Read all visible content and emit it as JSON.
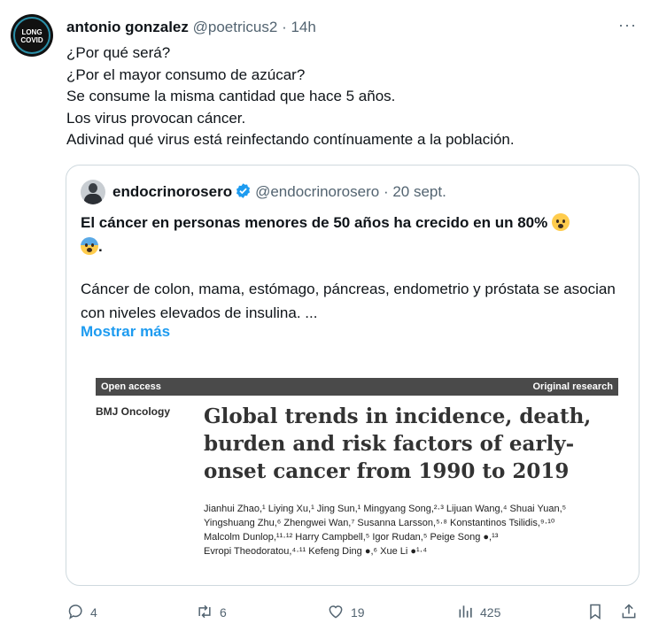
{
  "tweet": {
    "author_name": "antonio gonzalez",
    "handle": "@poetricus2",
    "separator": "·",
    "time": "14h",
    "more_label": "···",
    "avatar_text_1": "LONG",
    "avatar_text_2": "COVID",
    "lines": [
      "¿Por qué será?",
      "¿Por el mayor consumo de azúcar?",
      "Se consume la misma cantidad que hace 5 años.",
      "Los virus provocan cáncer.",
      "Adivinad qué virus está reinfectando contínuamente a la población."
    ]
  },
  "quote": {
    "author_name": "endocrinorosero",
    "handle": "@endocrinorosero",
    "separator": "·",
    "date": "20 sept.",
    "title": "El cáncer en personas menores de 50 años ha crecido en un 80%",
    "title_end": ".",
    "text": "Cáncer de colon, mama, estómago, páncreas, endometrio y próstata se asocian con niveles elevados de insulina. ...",
    "show_more": "Mostrar más",
    "paper": {
      "left_tag": "Open access",
      "right_tag": "Original research",
      "journal": "BMJ Oncology",
      "title": "Global trends in incidence, death, burden and risk factors of early-onset cancer from 1990 to 2019",
      "authors": [
        "Jianhui Zhao,¹ Liying Xu,¹ Jing Sun,¹ Mingyang Song,²·³ Lijuan Wang,⁴ Shuai Yuan,⁵",
        "Yingshuang Zhu,⁶ Zhengwei Wan,⁷ Susanna Larsson,⁵·⁸ Konstantinos Tsilidis,⁹·¹⁰",
        "Malcolm Dunlop,¹¹·¹² Harry Campbell,⁵ Igor Rudan,⁵ Peige Song ●,¹³",
        "Evropi Theodoratou,⁴·¹¹ Kefeng Ding ●,⁶ Xue Li ●¹·⁴"
      ]
    }
  },
  "actions": {
    "replies": "4",
    "retweets": "6",
    "likes": "19",
    "views": "425"
  },
  "colors": {
    "link": "#1d9bf0",
    "muted": "#536471",
    "border": "#cfd9de"
  }
}
